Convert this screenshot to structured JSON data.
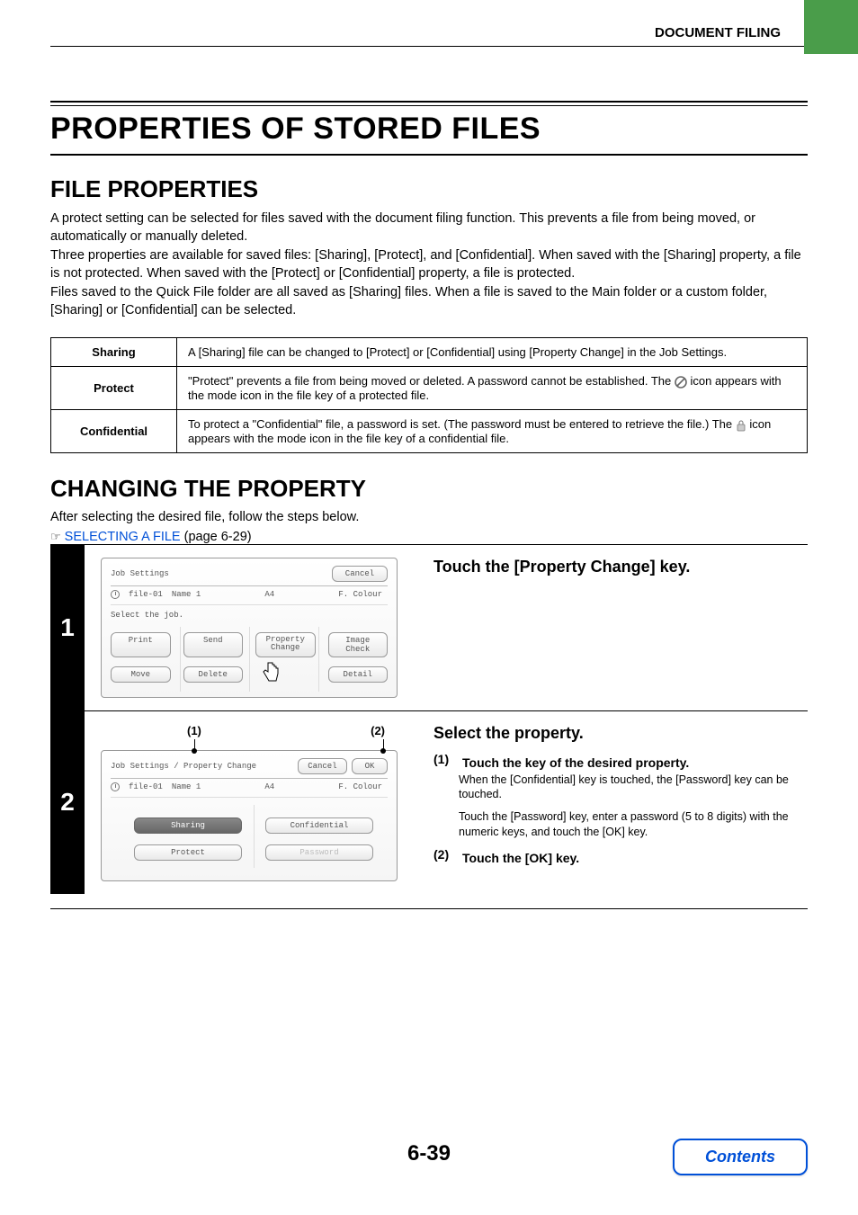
{
  "header": {
    "section": "DOCUMENT FILING"
  },
  "title": "PROPERTIES OF STORED FILES",
  "file_properties": {
    "heading": "FILE PROPERTIES",
    "p1": "A protect setting can be selected for files saved with the document filing function. This prevents a file from being moved, or automatically or manually deleted.",
    "p2": "Three properties are available for saved files: [Sharing], [Protect], and [Confidential]. When saved with the [Sharing] property, a file is not protected. When saved with the [Protect] or [Confidential] property, a file is protected.",
    "p3": "Files saved to the Quick File folder are all saved as [Sharing] files. When a file is saved to the Main folder or a custom folder, [Sharing] or [Confidential] can be selected.",
    "table": {
      "rows": [
        {
          "name": "Sharing",
          "desc": "A [Sharing] file can be changed to [Protect] or [Confidential] using [Property Change] in the Job Settings."
        },
        {
          "name": "Protect",
          "desc_a": "\"Protect\" prevents a file from being moved or deleted. A password cannot be established. The ",
          "desc_b": " icon appears with the mode icon in the file key of a protected file."
        },
        {
          "name": "Confidential",
          "desc_a": "To protect a \"Confidential\" file, a password is set. (The password must be entered to retrieve the file.) The ",
          "desc_b": " icon appears with the mode icon in the file key of a confidential file."
        }
      ]
    }
  },
  "changing": {
    "heading": "CHANGING THE PROPERTY",
    "intro": "After selecting the desired file, follow the steps below.",
    "link_label": "SELECTING A FILE",
    "link_page": " (page 6-29)"
  },
  "step1": {
    "num": "1",
    "heading": "Touch the [Property Change] key.",
    "panel": {
      "title": "Job Settings",
      "cancel": "Cancel",
      "file": "file-01",
      "name": "Name 1",
      "size": "A4",
      "mode": "F. Colour",
      "prompt": "Select the job.",
      "buttons": {
        "print": "Print",
        "send": "Send",
        "prop": "Property Change",
        "image": "Image Check",
        "move": "Move",
        "delete": "Delete",
        "detail": "Detail"
      }
    }
  },
  "step2": {
    "num": "2",
    "heading": "Select the property.",
    "callout1": "(1)",
    "callout2": "(2)",
    "sub1_head": "Touch the key of the desired property.",
    "sub1_body1": "When the [Confidential] key is touched, the [Password] key can be touched.",
    "sub1_body2": "Touch the [Password] key, enter a password (5 to 8 digits) with the numeric keys, and touch the [OK] key.",
    "sub2_head": "Touch the [OK] key.",
    "panel": {
      "title": "Job Settings / Property Change",
      "cancel": "Cancel",
      "ok": "OK",
      "file": "file-01",
      "name": "Name 1",
      "size": "A4",
      "mode": "F. Colour",
      "buttons": {
        "sharing": "Sharing",
        "confidential": "Confidential",
        "protect": "Protect",
        "password": "Password"
      }
    }
  },
  "footer": {
    "page": "6-39",
    "contents": "Contents"
  }
}
